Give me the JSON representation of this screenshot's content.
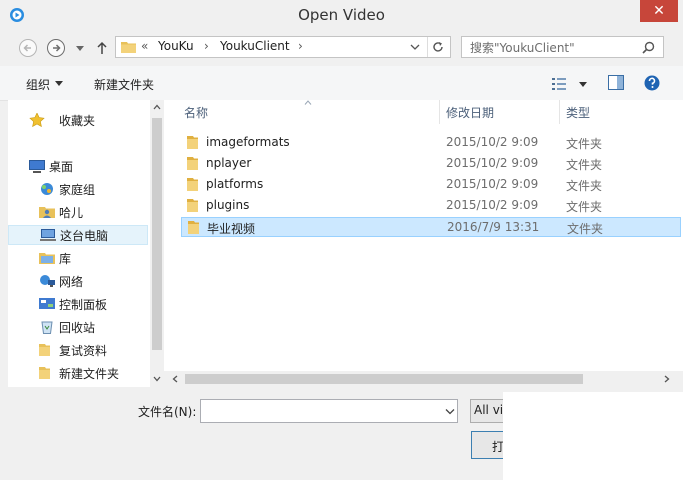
{
  "window": {
    "title": "Open Video",
    "close_glyph": "✕"
  },
  "address": {
    "overflow": "«",
    "crumbs": [
      "YouKu",
      "YoukuClient"
    ],
    "separator": "›"
  },
  "search": {
    "placeholder": "搜索\"YoukuClient\""
  },
  "toolbar": {
    "organize": "组织",
    "new_folder": "新建文件夹"
  },
  "nav": {
    "items": [
      {
        "label": "收藏夹",
        "icon": "star-icon"
      },
      {
        "label": "桌面",
        "icon": "desktop-icon"
      },
      {
        "label": "家庭组",
        "icon": "homegroup-icon"
      },
      {
        "label": "哈儿",
        "icon": "user-folder-icon"
      },
      {
        "label": "这台电脑",
        "icon": "computer-icon"
      },
      {
        "label": "库",
        "icon": "library-icon"
      },
      {
        "label": "网络",
        "icon": "network-icon"
      },
      {
        "label": "控制面板",
        "icon": "control-panel-icon"
      },
      {
        "label": "回收站",
        "icon": "recycle-bin-icon"
      },
      {
        "label": "复试资料",
        "icon": "folder-icon"
      },
      {
        "label": "新建文件夹",
        "icon": "folder-icon"
      }
    ]
  },
  "list": {
    "columns": {
      "name": "名称",
      "date": "修改日期",
      "type": "类型"
    },
    "rows": [
      {
        "name": "imageformats",
        "date": "2015/10/2 9:09",
        "type": "文件夹"
      },
      {
        "name": "nplayer",
        "date": "2015/10/2 9:09",
        "type": "文件夹"
      },
      {
        "name": "platforms",
        "date": "2015/10/2 9:09",
        "type": "文件夹"
      },
      {
        "name": "plugins",
        "date": "2015/10/2 9:09",
        "type": "文件夹"
      },
      {
        "name": "毕业视频",
        "date": "2016/7/9 13:31",
        "type": "文件夹"
      }
    ]
  },
  "bottom": {
    "filename_label": "文件名(N):",
    "filename_value": "",
    "filetype": "All vi",
    "open_label": "打"
  },
  "colors": {
    "accent": "#3c7fb1",
    "selection": "#cce8ff",
    "close": "#c7463a",
    "folder": "#e8c15a"
  }
}
